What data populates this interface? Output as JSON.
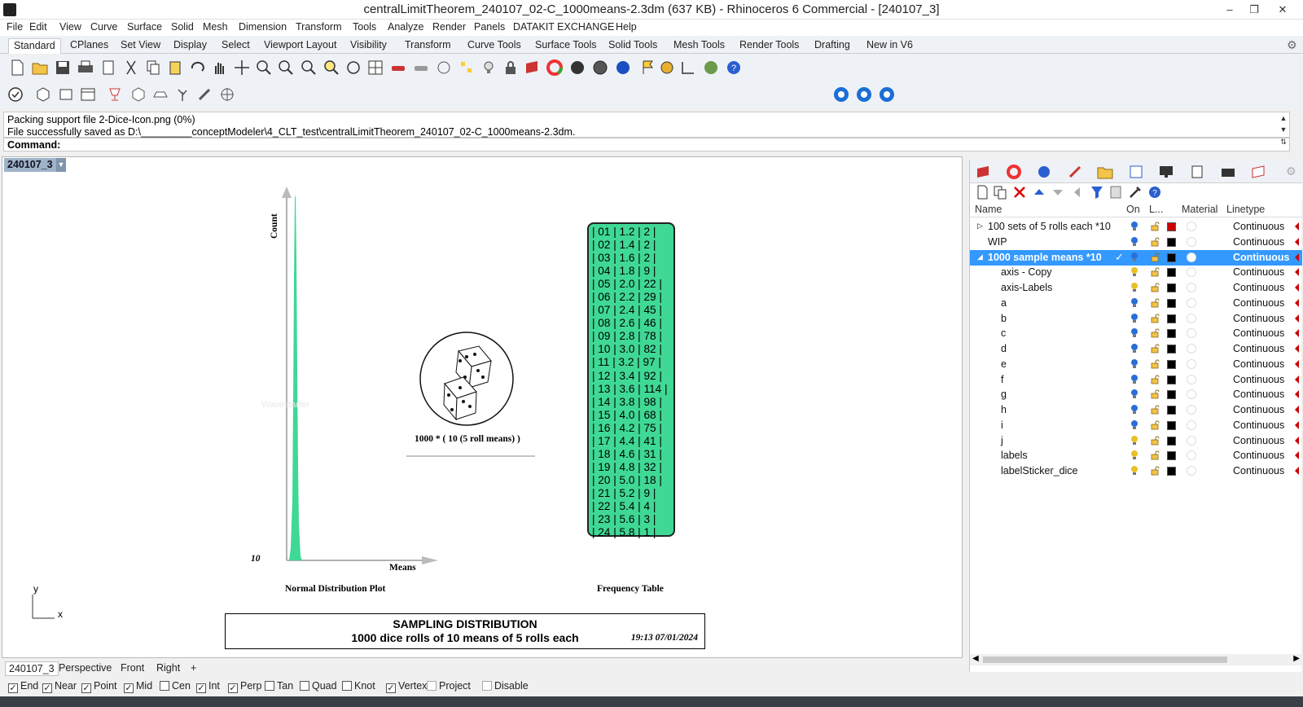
{
  "window": {
    "title": "centralLimitTheorem_240107_02-C_1000means-2.3dm (637 KB) - Rhinoceros 6 Commercial - [240107_3]",
    "controls": [
      "–",
      "❐",
      "✕"
    ]
  },
  "menu": [
    "File",
    "Edit",
    "View",
    "Curve",
    "Surface",
    "Solid",
    "Mesh",
    "Dimension",
    "Transform",
    "Tools",
    "Analyze",
    "Render",
    "Panels",
    "DATAKIT EXCHANGE",
    "Help"
  ],
  "toolbar_tabs": [
    "Standard",
    "CPlanes",
    "Set View",
    "Display",
    "Select",
    "Viewport Layout",
    "Visibility",
    "Transform",
    "Curve Tools",
    "Surface Tools",
    "Solid Tools",
    "Mesh Tools",
    "Render Tools",
    "Drafting",
    "New in V6"
  ],
  "command": {
    "history": [
      "Packing support file 2-Dice-Icon.png (0%)",
      "File successfully saved as D:\\_________conceptModeler\\4_CLT_test\\centralLimitTheorem_240107_02-C_1000means-2.3dm."
    ],
    "prompt": "Command:"
  },
  "viewport": {
    "label": "240107_3",
    "axis_y_label": "Count",
    "axis_x_label": "Means",
    "axis_corner_value": "10",
    "dice_caption": "1000 * ( 10 (5 roll means) )",
    "plot_caption": "Normal Distribution Plot",
    "table_caption": "Frequency Table",
    "watermark": "Wavestarter",
    "title_line1": "SAMPLING DISTRIBUTION",
    "title_line2": "1000 dice rolls of 10 means of 5 rolls each",
    "timestamp": "19:13 07/01/2024",
    "cplane_x": "x",
    "cplane_y": "y",
    "frequency_table": [
      "| 01 | 1.2 | 2 |",
      "| 02 | 1.4 | 2 |",
      "| 03 | 1.6 | 2 |",
      "| 04 | 1.8 | 9 |",
      "| 05 | 2.0 | 22 |",
      "| 06 | 2.2 | 29 |",
      "| 07 | 2.4 | 45 |",
      "| 08 | 2.6 | 46 |",
      "| 09 | 2.8 | 78 |",
      "| 10 | 3.0 | 82 |",
      "| 11 | 3.2 | 97 |",
      "| 12 | 3.4 | 92 |",
      "| 13 | 3.6 | 114 |",
      "| 14 | 3.8 | 98 |",
      "| 15 | 4.0 | 68 |",
      "| 16 | 4.2 | 75 |",
      "| 17 | 4.4 | 41 |",
      "| 18 | 4.6 | 31 |",
      "| 19 | 4.8 | 32 |",
      "| 20 | 5.0 | 18 |",
      "| 21 | 5.2 | 9 |",
      "| 22 | 5.4 | 4 |",
      "| 23 | 5.6 | 3 |",
      "| 24 | 5.8 | 1 |"
    ],
    "plot_color": "#3fd895"
  },
  "viewport_tabs": [
    "240107_3",
    "Perspective",
    "Front",
    "Right",
    "+"
  ],
  "osnaps": [
    {
      "label": "End",
      "checked": true
    },
    {
      "label": "Near",
      "checked": true
    },
    {
      "label": "Point",
      "checked": true
    },
    {
      "label": "Mid",
      "checked": true
    },
    {
      "label": "Cen",
      "checked": false
    },
    {
      "label": "Int",
      "checked": true
    },
    {
      "label": "Perp",
      "checked": true
    },
    {
      "label": "Tan",
      "checked": false
    },
    {
      "label": "Quad",
      "checked": false
    },
    {
      "label": "Knot",
      "checked": false
    },
    {
      "label": "Vertex",
      "checked": true
    },
    {
      "label": "Project",
      "checked": false,
      "disabled": true
    },
    {
      "label": "Disable",
      "checked": false,
      "disabled": true
    }
  ],
  "layers": {
    "headers": {
      "name": "Name",
      "on": "On",
      "lock": "L...",
      "material": "Material",
      "linetype": "Linetype"
    },
    "rows": [
      {
        "name": "100 sets of 5 rolls each *10",
        "indent": 1,
        "expander": "▷",
        "color": "#cc0000",
        "on": true,
        "linetype": "Continuous"
      },
      {
        "name": "WIP",
        "indent": 1,
        "color": "#000000",
        "on": true,
        "linetype": "Continuous"
      },
      {
        "name": "1000 sample means *10",
        "indent": 1,
        "expander": "◢",
        "color": "#000000",
        "on": true,
        "current": true,
        "selected": true,
        "linetype": "Continuous"
      },
      {
        "name": "axis - Copy",
        "indent": 2,
        "color": "#000000",
        "on": false,
        "linetype": "Continuous"
      },
      {
        "name": "axis-Labels",
        "indent": 2,
        "color": "#000000",
        "on": false,
        "linetype": "Continuous"
      },
      {
        "name": "a",
        "indent": 2,
        "color": "#000000",
        "on": true,
        "linetype": "Continuous"
      },
      {
        "name": "b",
        "indent": 2,
        "color": "#000000",
        "on": true,
        "linetype": "Continuous"
      },
      {
        "name": "c",
        "indent": 2,
        "color": "#000000",
        "on": true,
        "linetype": "Continuous"
      },
      {
        "name": "d",
        "indent": 2,
        "color": "#000000",
        "on": true,
        "linetype": "Continuous"
      },
      {
        "name": "e",
        "indent": 2,
        "color": "#000000",
        "on": true,
        "linetype": "Continuous"
      },
      {
        "name": "f",
        "indent": 2,
        "color": "#000000",
        "on": true,
        "linetype": "Continuous"
      },
      {
        "name": "g",
        "indent": 2,
        "color": "#000000",
        "on": true,
        "linetype": "Continuous"
      },
      {
        "name": "h",
        "indent": 2,
        "color": "#000000",
        "on": true,
        "linetype": "Continuous"
      },
      {
        "name": "i",
        "indent": 2,
        "color": "#000000",
        "on": true,
        "linetype": "Continuous"
      },
      {
        "name": "j",
        "indent": 2,
        "color": "#000000",
        "on": false,
        "linetype": "Continuous"
      },
      {
        "name": "labels",
        "indent": 2,
        "color": "#000000",
        "on": false,
        "linetype": "Continuous"
      },
      {
        "name": "labelSticker_dice",
        "indent": 2,
        "color": "#000000",
        "on": false,
        "linetype": "Continuous"
      }
    ]
  }
}
